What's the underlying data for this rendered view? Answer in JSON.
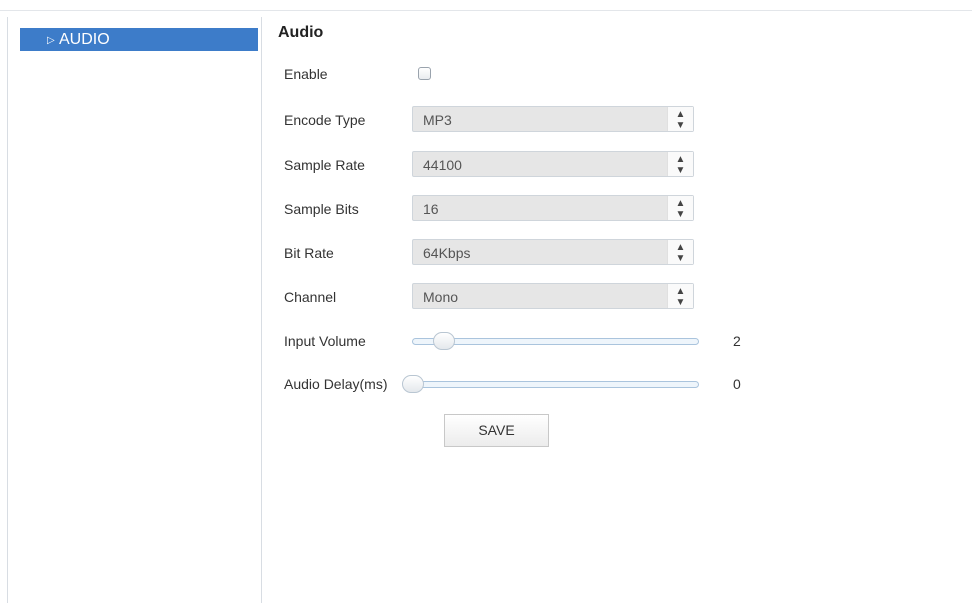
{
  "sidebar": {
    "items": [
      {
        "label": "AUDIO",
        "icon": "chevron-right-icon"
      }
    ]
  },
  "main": {
    "title": "Audio",
    "enable": {
      "label": "Enable",
      "checked": false
    },
    "encode_type": {
      "label": "Encode Type",
      "value": "MP3"
    },
    "sample_rate": {
      "label": "Sample Rate",
      "value": "44100"
    },
    "sample_bits": {
      "label": "Sample Bits",
      "value": "16"
    },
    "bit_rate": {
      "label": "Bit Rate",
      "value": "64Kbps"
    },
    "channel": {
      "label": "Channel",
      "value": "Mono"
    },
    "input_volume": {
      "label": "Input Volume",
      "value": "2"
    },
    "audio_delay": {
      "label": "Audio Delay(ms)",
      "value": "0"
    },
    "save_label": "SAVE"
  },
  "colors": {
    "accent": "#3d7cc9"
  }
}
